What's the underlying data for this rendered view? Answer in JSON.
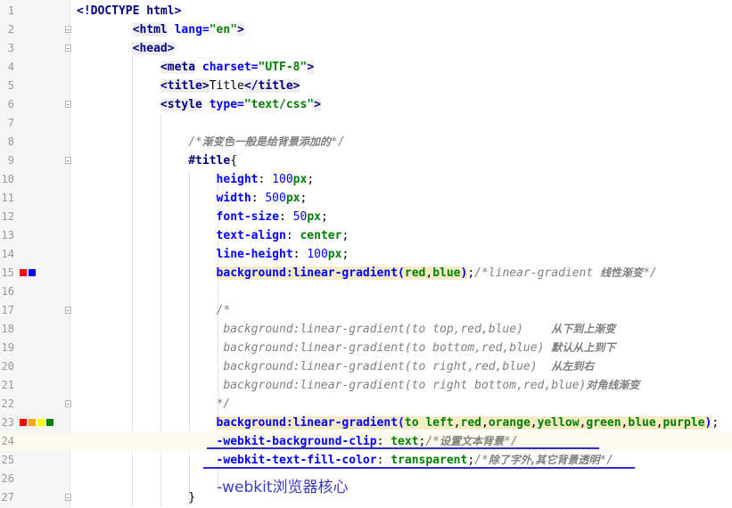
{
  "editor": {
    "lines": [
      {
        "n": "1",
        "tokens": [
          {
            "t": "<!DOCTYPE html>",
            "c": "t-doctype"
          }
        ]
      },
      {
        "n": "2",
        "fold": true,
        "tokens": [
          {
            "t": "        ",
            "c": "t-text"
          },
          {
            "t": "<html",
            "c": "t-tag"
          },
          {
            "t": " lang=",
            "c": "t-attr"
          },
          {
            "t": "\"en\"",
            "c": "t-str"
          },
          {
            "t": ">",
            "c": "t-tag"
          }
        ]
      },
      {
        "n": "3",
        "fold": true,
        "tokens": [
          {
            "t": "        ",
            "c": "t-text"
          },
          {
            "t": "<head>",
            "c": "t-tag"
          }
        ]
      },
      {
        "n": "4",
        "tokens": [
          {
            "t": "            ",
            "c": "t-text"
          },
          {
            "t": "<meta",
            "c": "t-tag"
          },
          {
            "t": " charset=",
            "c": "t-attr"
          },
          {
            "t": "\"UTF-8\"",
            "c": "t-str"
          },
          {
            "t": ">",
            "c": "t-tag"
          }
        ]
      },
      {
        "n": "5",
        "tokens": [
          {
            "t": "            ",
            "c": "t-text"
          },
          {
            "t": "<title>",
            "c": "t-tag"
          },
          {
            "t": "Title",
            "c": "t-text"
          },
          {
            "t": "</title>",
            "c": "t-tag"
          }
        ]
      },
      {
        "n": "6",
        "fold": true,
        "tokens": [
          {
            "t": "            ",
            "c": "t-text"
          },
          {
            "t": "<style",
            "c": "t-tag"
          },
          {
            "t": " type=",
            "c": "t-attr"
          },
          {
            "t": "\"text/css\"",
            "c": "t-str"
          },
          {
            "t": ">",
            "c": "t-tag"
          }
        ]
      },
      {
        "n": "7",
        "tokens": []
      },
      {
        "n": "8",
        "tokens": [
          {
            "t": "                ",
            "c": "t-text"
          },
          {
            "t": "/*",
            "c": "t-comment"
          },
          {
            "t": "渐变色一般是给背景添加的",
            "c": "t-comment-cn"
          },
          {
            "t": "*/",
            "c": "t-comment"
          }
        ]
      },
      {
        "n": "9",
        "fold": true,
        "tokens": [
          {
            "t": "                ",
            "c": "t-text"
          },
          {
            "t": "#title",
            "c": "t-selector"
          },
          {
            "t": "{",
            "c": "t-punct"
          }
        ]
      },
      {
        "n": "10",
        "tokens": [
          {
            "t": "                    ",
            "c": "t-text"
          },
          {
            "t": "height",
            "c": "t-prop"
          },
          {
            "t": ": ",
            "c": "t-punct"
          },
          {
            "t": "100",
            "c": "t-num"
          },
          {
            "t": "px",
            "c": "t-val"
          },
          {
            "t": ";",
            "c": "t-punct"
          }
        ]
      },
      {
        "n": "11",
        "tokens": [
          {
            "t": "                    ",
            "c": "t-text"
          },
          {
            "t": "width",
            "c": "t-prop"
          },
          {
            "t": ": ",
            "c": "t-punct"
          },
          {
            "t": "500",
            "c": "t-num"
          },
          {
            "t": "px",
            "c": "t-val"
          },
          {
            "t": ";",
            "c": "t-punct"
          }
        ]
      },
      {
        "n": "12",
        "tokens": [
          {
            "t": "                    ",
            "c": "t-text"
          },
          {
            "t": "font-size",
            "c": "t-prop"
          },
          {
            "t": ": ",
            "c": "t-punct"
          },
          {
            "t": "50",
            "c": "t-num"
          },
          {
            "t": "px",
            "c": "t-val"
          },
          {
            "t": ";",
            "c": "t-punct"
          }
        ]
      },
      {
        "n": "13",
        "tokens": [
          {
            "t": "                    ",
            "c": "t-text"
          },
          {
            "t": "text-align",
            "c": "t-prop"
          },
          {
            "t": ": ",
            "c": "t-punct"
          },
          {
            "t": "center",
            "c": "t-val"
          },
          {
            "t": ";",
            "c": "t-punct"
          }
        ]
      },
      {
        "n": "14",
        "tokens": [
          {
            "t": "                    ",
            "c": "t-text"
          },
          {
            "t": "line-height",
            "c": "t-prop"
          },
          {
            "t": ": ",
            "c": "t-punct"
          },
          {
            "t": "100",
            "c": "t-num"
          },
          {
            "t": "px",
            "c": "t-val"
          },
          {
            "t": ";",
            "c": "t-punct"
          }
        ]
      },
      {
        "n": "15",
        "swatches": [
          "#ff0000",
          "#0000ff"
        ],
        "tokens": [
          {
            "t": "                    ",
            "c": "t-text"
          },
          {
            "t": "background:linear-gradient(",
            "c": "t-prop hl-row"
          },
          {
            "t": "red",
            "c": "t-val hl-row"
          },
          {
            "t": ",",
            "c": "t-punct hl-row"
          },
          {
            "t": "blue",
            "c": "t-val hl-row"
          },
          {
            "t": ")",
            "c": "t-prop hl-row"
          },
          {
            "t": ";",
            "c": "t-punct"
          },
          {
            "t": "/*linear-gradient ",
            "c": "t-comment"
          },
          {
            "t": "线性渐变",
            "c": "t-comment-cn"
          },
          {
            "t": "*/",
            "c": "t-comment"
          }
        ]
      },
      {
        "n": "16",
        "tokens": []
      },
      {
        "n": "17",
        "fold": true,
        "tokens": [
          {
            "t": "                    ",
            "c": "t-text"
          },
          {
            "t": "/*",
            "c": "t-comment"
          }
        ]
      },
      {
        "n": "18",
        "tokens": [
          {
            "t": "                     background:linear-gradient(to top,red,blue)    ",
            "c": "t-comment"
          },
          {
            "t": "从下到上渐变",
            "c": "t-comment-cn"
          }
        ]
      },
      {
        "n": "19",
        "tokens": [
          {
            "t": "                     background:linear-gradient(to bottom,red,blue) ",
            "c": "t-comment"
          },
          {
            "t": "默认从上到下",
            "c": "t-comment-cn"
          }
        ]
      },
      {
        "n": "20",
        "tokens": [
          {
            "t": "                     background:linear-gradient(to right,red,blue)  ",
            "c": "t-comment"
          },
          {
            "t": "从左到右",
            "c": "t-comment-cn"
          }
        ]
      },
      {
        "n": "21",
        "tokens": [
          {
            "t": "                     background:linear-gradient(to right bottom,red,blue)",
            "c": "t-comment"
          },
          {
            "t": "对角线渐变",
            "c": "t-comment-cn"
          }
        ]
      },
      {
        "n": "22",
        "fold": true,
        "tokens": [
          {
            "t": "                    ",
            "c": "t-text"
          },
          {
            "t": "*/",
            "c": "t-comment"
          }
        ]
      },
      {
        "n": "23",
        "swatches": [
          "#ff0000",
          "#ffa500",
          "#ffff00",
          "#008000"
        ],
        "tokens": [
          {
            "t": "                    ",
            "c": "t-text"
          },
          {
            "t": "background:linear-gradient(",
            "c": "t-prop hl-row"
          },
          {
            "t": "to left",
            "c": "t-val hl-row"
          },
          {
            "t": ",",
            "c": "t-punct hl-row"
          },
          {
            "t": "red",
            "c": "t-val hl-row"
          },
          {
            "t": ",",
            "c": "t-punct hl-row"
          },
          {
            "t": "orange",
            "c": "t-val hl-row"
          },
          {
            "t": ",",
            "c": "t-punct hl-row"
          },
          {
            "t": "yellow",
            "c": "t-val hl-row"
          },
          {
            "t": ",",
            "c": "t-punct hl-row"
          },
          {
            "t": "green",
            "c": "t-val hl-row"
          },
          {
            "t": ",",
            "c": "t-punct hl-row"
          },
          {
            "t": "blue",
            "c": "t-val hl-row"
          },
          {
            "t": ",",
            "c": "t-punct hl-row"
          },
          {
            "t": "purple",
            "c": "t-val hl-row"
          },
          {
            "t": ")",
            "c": "t-prop hl-row"
          },
          {
            "t": ";",
            "c": "t-punct"
          }
        ]
      },
      {
        "n": "24",
        "current": true,
        "tokens": [
          {
            "t": "                    ",
            "c": "t-text"
          },
          {
            "t": "-webkit-background-clip",
            "c": "t-prop"
          },
          {
            "t": ": ",
            "c": "t-punct"
          },
          {
            "t": "text",
            "c": "t-val"
          },
          {
            "t": ";",
            "c": "t-punct"
          },
          {
            "t": "/*",
            "c": "t-comment"
          },
          {
            "t": "设置文本背景",
            "c": "t-comment-cn"
          },
          {
            "t": "*/",
            "c": "t-comment"
          }
        ]
      },
      {
        "n": "25",
        "tokens": [
          {
            "t": "                    ",
            "c": "t-text"
          },
          {
            "t": "-webkit-text-fill-color",
            "c": "t-prop"
          },
          {
            "t": ": ",
            "c": "t-punct"
          },
          {
            "t": "transparent",
            "c": "t-val"
          },
          {
            "t": ";",
            "c": "t-punct"
          },
          {
            "t": "/*",
            "c": "t-comment"
          },
          {
            "t": "除了字外,其它背景透明",
            "c": "t-comment-cn"
          },
          {
            "t": "*/",
            "c": "t-comment"
          }
        ]
      },
      {
        "n": "26",
        "tokens": []
      },
      {
        "n": "27",
        "fold": true,
        "tokens": [
          {
            "t": "                ",
            "c": "t-text"
          },
          {
            "t": "}",
            "c": "t-punct"
          }
        ]
      }
    ]
  },
  "annotation": {
    "text": "-webkit浏览器核心",
    "color": "#3a3ac8"
  }
}
